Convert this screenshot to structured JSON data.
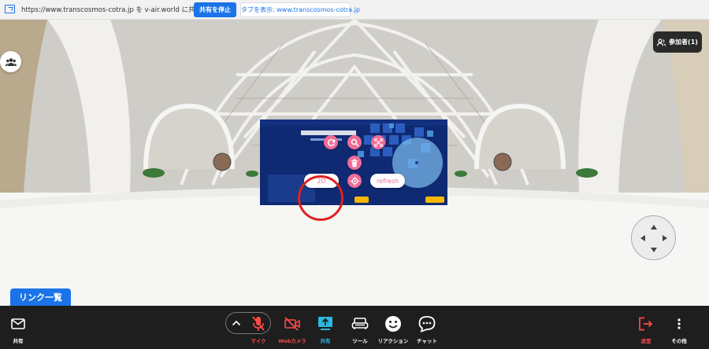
{
  "sharebar": {
    "text": "https://www.transcosmos-cotra.jp を v-air.world に共有しています",
    "stop_label": "共有を停止",
    "show_tab_label": "タブを表示: www.transcosmos-cotra.jp"
  },
  "participants": {
    "label": "参加者(1)"
  },
  "screen_ui": {
    "btn_2d": "2D",
    "btn_refresh": "refresh"
  },
  "link_list": {
    "label": "リンク一覧"
  },
  "toolbar": {
    "share_label": "共有",
    "mic_label": "マイク",
    "webcam_label": "Webカメラ",
    "screenshare_label": "共有",
    "tool_label": "ツール",
    "reaction_label": "リアクション",
    "chat_label": "チャット",
    "leave_label": "退室",
    "more_label": "その他"
  },
  "colors": {
    "accent": "#1a73e8",
    "pink": "#f06d98",
    "danger": "#ff4a4a",
    "toolbar_bg": "#1e1e1e"
  },
  "icons": [
    "share-screen-icon",
    "group-icon",
    "person-icon",
    "sync-icon",
    "search-icon",
    "expand-icon",
    "trash-icon",
    "target-icon",
    "mail-icon",
    "chevron-up-icon",
    "mic-off-icon",
    "video-off-icon",
    "upload-icon",
    "sofa-icon",
    "smiley-icon",
    "chat-icon",
    "logout-icon",
    "more-vertical-icon"
  ]
}
